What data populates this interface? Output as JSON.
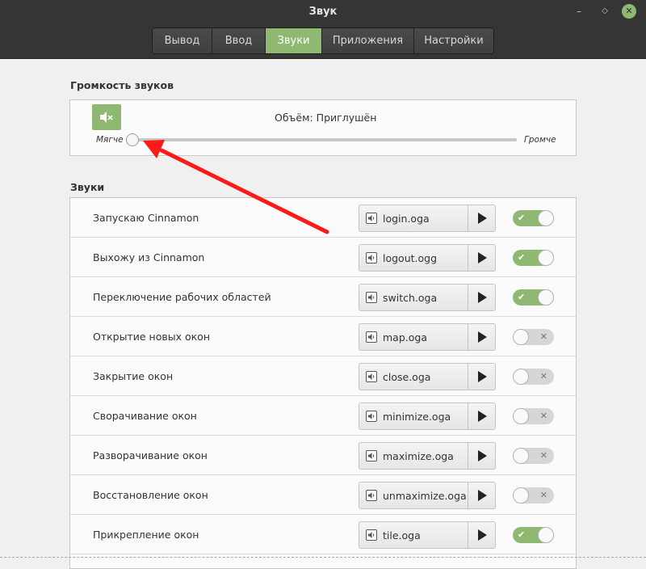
{
  "window": {
    "title": "Звук"
  },
  "tabs": [
    {
      "label": "Вывод",
      "active": false
    },
    {
      "label": "Ввод",
      "active": false
    },
    {
      "label": "Звуки",
      "active": true
    },
    {
      "label": "Приложения",
      "active": false
    },
    {
      "label": "Настройки",
      "active": false
    }
  ],
  "volume": {
    "section_title": "Громкость звуков",
    "label": "Объём: Приглушён",
    "softer": "Мягче",
    "louder": "Громче",
    "level": 0,
    "muted": true
  },
  "sounds": {
    "section_title": "Звуки",
    "items": [
      {
        "label": "Запускаю Cinnamon",
        "file": "login.oga",
        "enabled": true
      },
      {
        "label": "Выхожу из Cinnamon",
        "file": "logout.ogg",
        "enabled": true
      },
      {
        "label": "Переключение рабочих областей",
        "file": "switch.oga",
        "enabled": true
      },
      {
        "label": "Открытие новых окон",
        "file": "map.oga",
        "enabled": false
      },
      {
        "label": "Закрытие окон",
        "file": "close.oga",
        "enabled": false
      },
      {
        "label": "Сворачивание окон",
        "file": "minimize.oga",
        "enabled": false
      },
      {
        "label": "Разворачивание окон",
        "file": "maximize.oga",
        "enabled": false
      },
      {
        "label": "Восстановление окон",
        "file": "unmaximize.oga",
        "enabled": false
      },
      {
        "label": "Прикрепление окон",
        "file": "tile.oga",
        "enabled": true
      }
    ]
  },
  "colors": {
    "accent": "#8fb973",
    "titlebar": "#353535",
    "annotation": "#ff1a1a"
  },
  "icons": {
    "mute": "speaker-muted-icon",
    "file": "audio-file-icon",
    "play": "play-icon"
  }
}
